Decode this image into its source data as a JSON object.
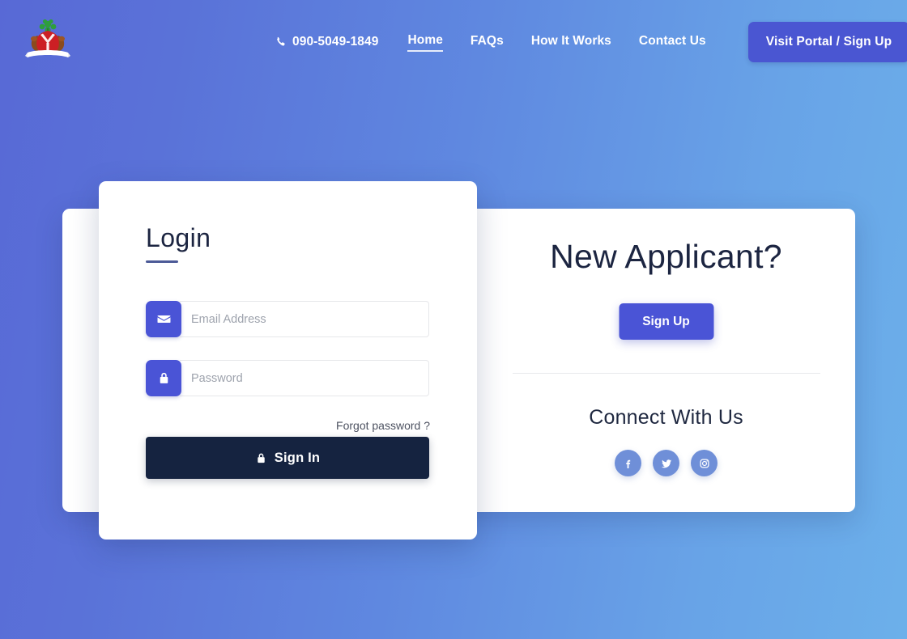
{
  "header": {
    "logo_name": "nigeria-coat-of-arms-logo",
    "phone": {
      "icon": "phone-icon",
      "number": "090-5049-1849"
    },
    "nav_items": [
      {
        "label": "Home",
        "active": true
      },
      {
        "label": "FAQs",
        "active": false
      },
      {
        "label": "How It Works",
        "active": false
      },
      {
        "label": "Contact Us",
        "active": false
      }
    ],
    "portal_button": "Visit Portal / Sign Up"
  },
  "login": {
    "heading": "Login",
    "email": {
      "icon": "envelope-icon",
      "placeholder": "Email Address",
      "value": ""
    },
    "password": {
      "icon": "lock-icon",
      "placeholder": "Password",
      "value": ""
    },
    "forgot_link": "Forgot password ?",
    "submit_button": {
      "icon": "lock-icon",
      "label": "Sign In"
    }
  },
  "applicant": {
    "heading": "New Applicant?",
    "signup_button": "Sign Up",
    "connect_heading": "Connect With Us",
    "social_links": [
      {
        "name": "facebook",
        "icon": "facebook-icon"
      },
      {
        "name": "twitter",
        "icon": "twitter-icon"
      },
      {
        "name": "instagram",
        "icon": "instagram-icon"
      }
    ]
  },
  "colors": {
    "bg_gradient_start": "#5869d6",
    "bg_gradient_end": "#6cb0ea",
    "accent_indigo": "#4a54d6",
    "portal_button": "#4a56d2",
    "signin_navy": "#152340",
    "heading_navy": "#1c2541",
    "social_blue": "#6f8fd8",
    "card_white": "#ffffff"
  }
}
